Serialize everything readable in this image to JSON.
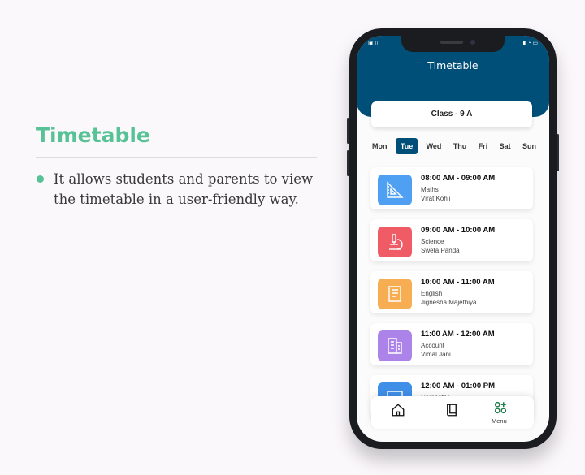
{
  "info": {
    "heading": "Timetable",
    "bullet": "It allows students and parents to view the timetable in a user-friendly way."
  },
  "app": {
    "title": "Timetable",
    "class_label": "Class - 9 A",
    "days": [
      "Mon",
      "Tue",
      "Wed",
      "Thu",
      "Fri",
      "Sat",
      "Sun"
    ],
    "selected_day": "Tue",
    "schedule": [
      {
        "time": "08:00 AM - 09:00 AM",
        "subject": "Maths",
        "teacher": "Virat Kohli",
        "color": "#4f9ff2",
        "icon": "ruler-icon"
      },
      {
        "time": "09:00 AM - 10:00 AM",
        "subject": "Science",
        "teacher": "Sweta Panda",
        "color": "#f05c66",
        "icon": "microscope-icon"
      },
      {
        "time": "10:00 AM - 11:00 AM",
        "subject": "English",
        "teacher": "Jignesha Majethiya",
        "color": "#f7ad52",
        "icon": "book-icon"
      },
      {
        "time": "11:00 AM - 12:00 AM",
        "subject": "Account",
        "teacher": "Vimal Jani",
        "color": "#ac83e9",
        "icon": "ledger-icon"
      },
      {
        "time": "12:00 AM - 01:00 PM",
        "subject": "Computer",
        "teacher": "",
        "color": "#3f8fe8",
        "icon": "monitor-icon"
      }
    ],
    "nav": {
      "home_icon": "home-icon",
      "book_icon": "book-icon",
      "menu_icon": "menu-grid-icon",
      "menu_label": "Menu"
    },
    "accent": "#004f78",
    "brand_green": "#58c297"
  }
}
